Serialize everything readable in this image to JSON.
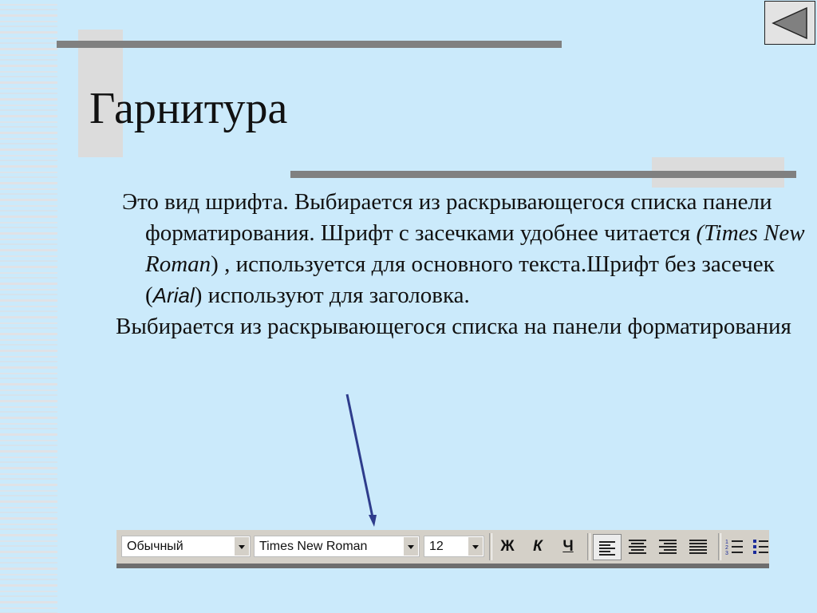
{
  "slide": {
    "title": "Гарнитура",
    "back_button_label": "Назад",
    "paragraph1": {
      "part1": "Это вид шрифта. Выбирается из раскрывающегося списка панели форматирования.  Шрифт с засечками удобнее читается ",
      "serif_example": "(Times New   Roman",
      "part2": ") , используется для основного текста.Шрифт без засечек (",
      "sans_example": "Arial",
      "part3": ") используют для заголовка."
    },
    "paragraph2": "Выбирается из раскрывающегося списка на панели форматирования",
    "colors": {
      "background": "#cbeafb",
      "accent_bar": "#808080",
      "arrow": "#2e3c8c"
    }
  },
  "toolbar": {
    "style_combo": "Обычный",
    "font_combo": "Times New Roman",
    "size_combo": "12",
    "bold_label": "Ж",
    "italic_label": "К",
    "underline_label": "Ч",
    "align_left": "align-left",
    "align_center": "align-center",
    "align_right": "align-right",
    "align_justify": "align-justify",
    "numbered_list": "numbered-list",
    "bulleted_list": "bulleted-list"
  }
}
